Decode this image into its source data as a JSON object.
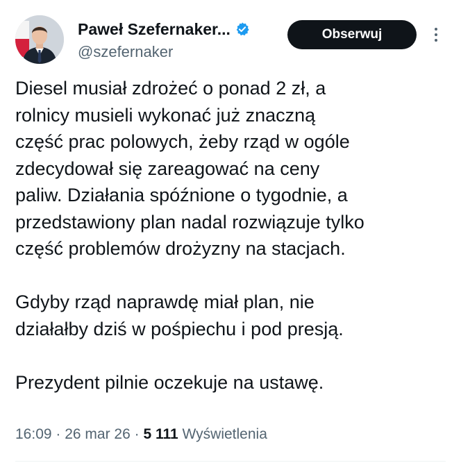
{
  "author": {
    "display_name": "Paweł Szefernaker...",
    "handle": "@szefernaker",
    "verified": true,
    "avatar": "profile-photo"
  },
  "actions": {
    "follow_label": "Obserwuj",
    "more_icon": "more-vertical-icon"
  },
  "tweet": {
    "paragraph_1": [
      "Diesel musiał zdrożeć o ponad 2 zł, a",
      "rolnicy musieli wykonać już znaczną",
      "część prac polowych, żeby rząd w ogóle",
      "zdecydował się zareagować na ceny",
      "paliw. Działania spóźnione o tygodnie, a",
      "przedstawiony plan nadal rozwiązuje tylko",
      "część problemów drożyzny na stacjach."
    ],
    "paragraph_2": [
      "Gdyby rząd naprawdę miał plan, nie",
      "działałby dziś w pośpiechu i pod presją."
    ],
    "paragraph_3": [
      "Prezydent pilnie oczekuje na ustawę."
    ]
  },
  "meta": {
    "time": "16:09",
    "sep_1": " · ",
    "date": "26 mar 26",
    "sep_2": " · ",
    "views_count": "5 111",
    "views_label": " Wyświetlenia"
  },
  "colors": {
    "text_primary": "#0f1419",
    "text_secondary": "#536471",
    "verified_blue": "#1d9bf0",
    "button_bg": "#0f1419",
    "divider": "#eff3f4"
  }
}
